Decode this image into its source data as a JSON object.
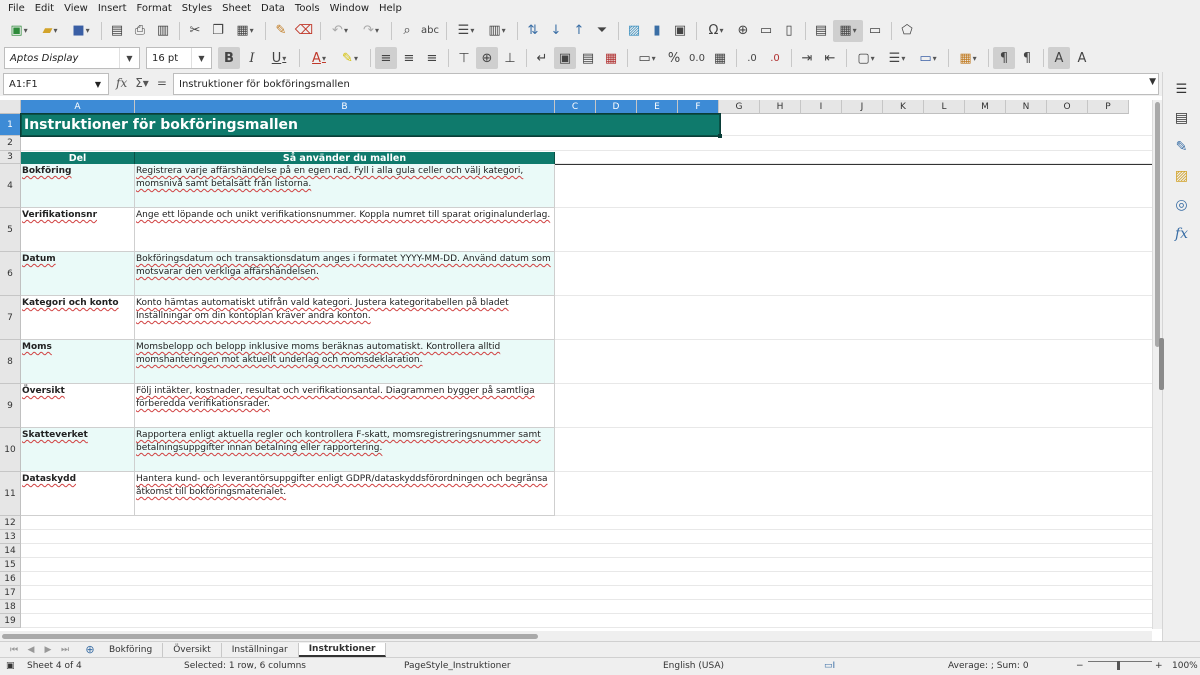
{
  "menu": [
    "File",
    "Edit",
    "View",
    "Insert",
    "Format",
    "Styles",
    "Sheet",
    "Data",
    "Tools",
    "Window",
    "Help"
  ],
  "toolbar": {
    "font_name": "Aptos Display",
    "font_size": "16 pt",
    "bold": "B",
    "italic": "I",
    "underline": "U",
    "percent": "%",
    "number": "0.0"
  },
  "formula_bar": {
    "cell_ref": "A1:F1",
    "content": "Instruktioner för bokföringsmallen"
  },
  "columns": [
    "A",
    "B",
    "C",
    "D",
    "E",
    "F",
    "G",
    "H",
    "I",
    "J",
    "K",
    "L",
    "M",
    "N",
    "O",
    "P"
  ],
  "rows": [
    "1",
    "2",
    "3",
    "4",
    "5",
    "6",
    "7",
    "8",
    "9",
    "10",
    "11",
    "12",
    "13",
    "14",
    "15",
    "16",
    "17",
    "18",
    "19"
  ],
  "sheet": {
    "title": "Instruktioner för bokföringsmallen",
    "header_del": "Del",
    "header_how": "Så använder du mallen",
    "entries": [
      {
        "label": "Bokföring",
        "text": "Registrera varje affärshändelse på en egen rad. Fyll i alla gula celler och välj kategori, momsnivå samt betalsätt från listorna."
      },
      {
        "label": "Verifikationsnr",
        "text": "Ange ett löpande och unikt verifikationsnummer. Koppla numret till sparat originalunderlag."
      },
      {
        "label": "Datum",
        "text": "Bokföringsdatum och transaktionsdatum anges i formatet YYYY-MM-DD. Använd datum som motsvarar den verkliga affärshändelsen."
      },
      {
        "label": "Kategori och konto",
        "text": "Konto hämtas automatiskt utifrån vald kategori. Justera kategoritabellen på bladet Inställningar om din kontoplan kräver andra konton."
      },
      {
        "label": "Moms",
        "text": "Momsbelopp och belopp inklusive moms beräknas automatiskt. Kontrollera alltid momshanteringen mot aktuellt underlag och momsdeklaration."
      },
      {
        "label": "Översikt",
        "text": "Följ intäkter, kostnader, resultat och verifikationsantal. Diagrammen bygger på samtliga förberedda verifikationsrader."
      },
      {
        "label": "Skatteverket",
        "text": "Rapportera enligt aktuella regler och kontrollera F-skatt, momsregistreringsnummer samt betalningsuppgifter innan betalning eller rapportering."
      },
      {
        "label": "Dataskydd",
        "text": "Hantera kund- och leverantörsuppgifter enligt GDPR/dataskyddsförordningen och begränsa åtkomst till bokföringsmaterialet."
      }
    ]
  },
  "tabs": [
    "Bokföring",
    "Översikt",
    "Inställningar",
    "Instruktioner"
  ],
  "active_tab": "Instruktioner",
  "status": {
    "sheet": "Sheet 4 of 4",
    "selection": "Selected: 1 row, 6 columns",
    "page_style": "PageStyle_Instruktioner",
    "language": "English (USA)",
    "summary": "Average: ; Sum: 0",
    "zoom": "100%"
  },
  "colors": {
    "header_teal": "#0f7a6c",
    "alt_row": "#eafaf8",
    "selection_blue": "#3d8bd6"
  }
}
